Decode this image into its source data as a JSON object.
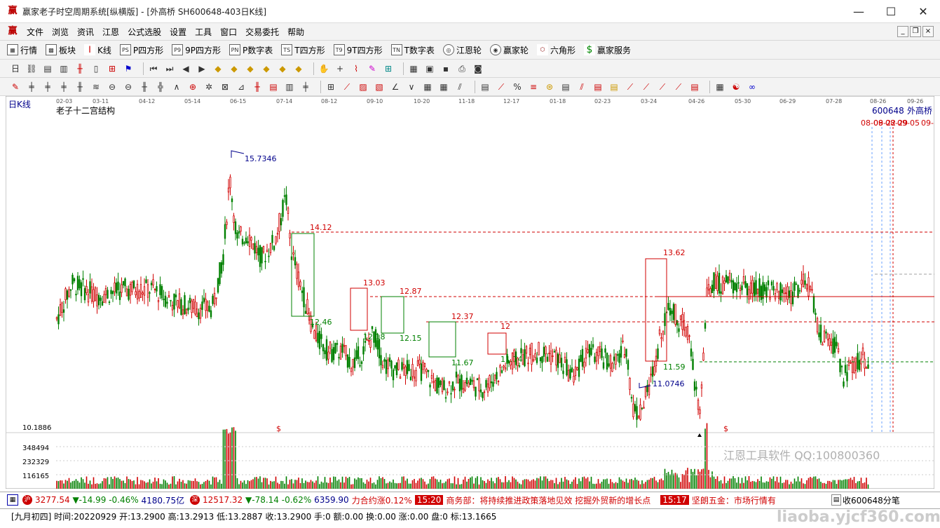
{
  "window": {
    "title": "赢家老子时空周期系统[纵横版] - [外高桥   SH600648-403日K线]",
    "app_icon": "赢"
  },
  "menu": [
    "文件",
    "浏览",
    "资讯",
    "江恩",
    "公式选股",
    "设置",
    "工具",
    "窗口",
    "交易委托",
    "帮助"
  ],
  "toolbar1": [
    {
      "icon": "table-icon",
      "label": "行情"
    },
    {
      "icon": "blocks-icon",
      "label": "板块"
    },
    {
      "icon": "kline-icon",
      "label": "K线"
    },
    {
      "icon": "PS",
      "label": "P四方形"
    },
    {
      "icon": "P9",
      "label": "9P四方形"
    },
    {
      "icon": "PN",
      "label": "P数字表"
    },
    {
      "icon": "TS",
      "label": "T四方形"
    },
    {
      "icon": "T9",
      "label": "9T四方形"
    },
    {
      "icon": "TN",
      "label": "T数字表"
    },
    {
      "icon": "wheel-icon",
      "label": "江恩轮"
    },
    {
      "icon": "wheel2-icon",
      "label": "赢家轮"
    },
    {
      "icon": "hexagon-icon",
      "label": "六角形"
    },
    {
      "icon": "dollar-icon",
      "label": "赢家服务"
    }
  ],
  "chart": {
    "period_label": "日K线",
    "indicator_name": "老子十二宫结构",
    "stock_code": "600648",
    "stock_name": "外高桥",
    "date_axis": [
      "02-03",
      "03-11",
      "04-12",
      "05-14",
      "06-15",
      "07-14",
      "08-12",
      "09-10",
      "10-20",
      "11-18",
      "12-17",
      "01-18",
      "02-23",
      "03-24",
      "04-26",
      "05-30",
      "06-29",
      "07-28",
      "08-26",
      "09-26"
    ],
    "future_dates": [
      "08-09",
      "08-22",
      "08-29",
      "09-05",
      "09-"
    ],
    "high_mark": "15.7346",
    "low_mark": "11.0746",
    "levels": [
      "14.12",
      "13.03",
      "12.87",
      "12.37",
      "13.62",
      "12.46",
      "12.18",
      "12.15",
      "11.67",
      "11.74",
      "11.59",
      "12"
    ],
    "volume_axis": [
      "10.1886",
      "348494",
      "232329",
      "116165"
    ],
    "dollar_mark": "$",
    "colors": {
      "up": "#d00000",
      "down": "#008000",
      "level": "#d00000",
      "box_green": "#008000",
      "box_red": "#d00000"
    }
  },
  "ticker": {
    "sh_value": "3277.54",
    "sh_change": "▼-14.99",
    "sh_pct": "-0.46%",
    "sh_amount": "4180.75亿",
    "sz_value": "12517.32",
    "sz_change": "▼-78.14",
    "sz_pct": "-0.62%",
    "sz_amount": "6359.90",
    "news1": "力合约涨0.12%",
    "time1": "15:20",
    "news2": "商务部：将持续推进政策落地见效 挖掘外贸新的增长点",
    "time2": "15:17",
    "news3": "坚朗五金：市场行情有",
    "right_label": "收600648分笔"
  },
  "status": "[九月初四] 时间:20220929 开:13.2900 高:13.2913 低:13.2887 收:13.2900 手:0 额:0.00 换:0.00 涨:0.00 盘:0 标:13.1665",
  "watermark": "江恩工具软件  QQ:100800360",
  "watermark2": "liaoba.yjcf360.com"
}
